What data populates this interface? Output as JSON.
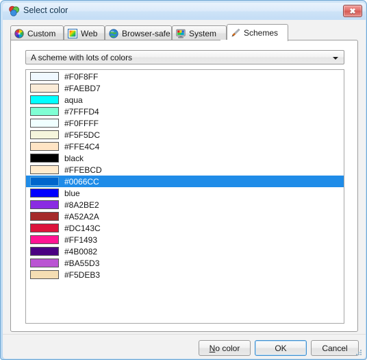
{
  "window": {
    "title": "Select color",
    "icon": "color-circles-icon",
    "close_label": "✖"
  },
  "tabs": [
    {
      "id": "custom",
      "label": "Custom",
      "icon": "color-wheel-icon",
      "active": false
    },
    {
      "id": "web",
      "label": "Web",
      "icon": "web-palette-icon",
      "active": false
    },
    {
      "id": "browser-safe",
      "label": "Browser-safe",
      "icon": "globe-icon",
      "active": false
    },
    {
      "id": "system",
      "label": "System",
      "icon": "monitor-icon",
      "active": false
    },
    {
      "id": "schemes",
      "label": "Schemes",
      "icon": "paintbrush-icon",
      "active": true
    }
  ],
  "scheme_combo": {
    "value": "A scheme with lots of colors",
    "arrow_icon": "chevron-down-icon"
  },
  "color_list": {
    "selected_index": 9,
    "selection_color": "#1f8ce8",
    "items": [
      {
        "label": "#F0F8FF",
        "swatch": "#F0F8FF"
      },
      {
        "label": "#FAEBD7",
        "swatch": "#FAEBD7"
      },
      {
        "label": "aqua",
        "swatch": "#00FFFF"
      },
      {
        "label": "#7FFFD4",
        "swatch": "#7FFFD4"
      },
      {
        "label": "#F0FFFF",
        "swatch": "#F0FFFF"
      },
      {
        "label": "#F5F5DC",
        "swatch": "#F5F5DC"
      },
      {
        "label": "#FFE4C4",
        "swatch": "#FFE4C4"
      },
      {
        "label": "black",
        "swatch": "#000000"
      },
      {
        "label": "#FFEBCD",
        "swatch": "#FFEBCD"
      },
      {
        "label": "#0066CC",
        "swatch": "#0066CC"
      },
      {
        "label": "blue",
        "swatch": "#0000FF"
      },
      {
        "label": "#8A2BE2",
        "swatch": "#8A2BE2"
      },
      {
        "label": "#A52A2A",
        "swatch": "#A52A2A"
      },
      {
        "label": "#DC143C",
        "swatch": "#DC143C"
      },
      {
        "label": "#FF1493",
        "swatch": "#FF1493"
      },
      {
        "label": "#4B0082",
        "swatch": "#4B0082"
      },
      {
        "label": "#BA55D3",
        "swatch": "#BA55D3"
      },
      {
        "label": "#F5DEB3",
        "swatch": "#F5DEB3"
      }
    ]
  },
  "buttons": {
    "no_color": {
      "accel": "N",
      "rest": "o color"
    },
    "ok": "OK",
    "cancel": "Cancel"
  }
}
